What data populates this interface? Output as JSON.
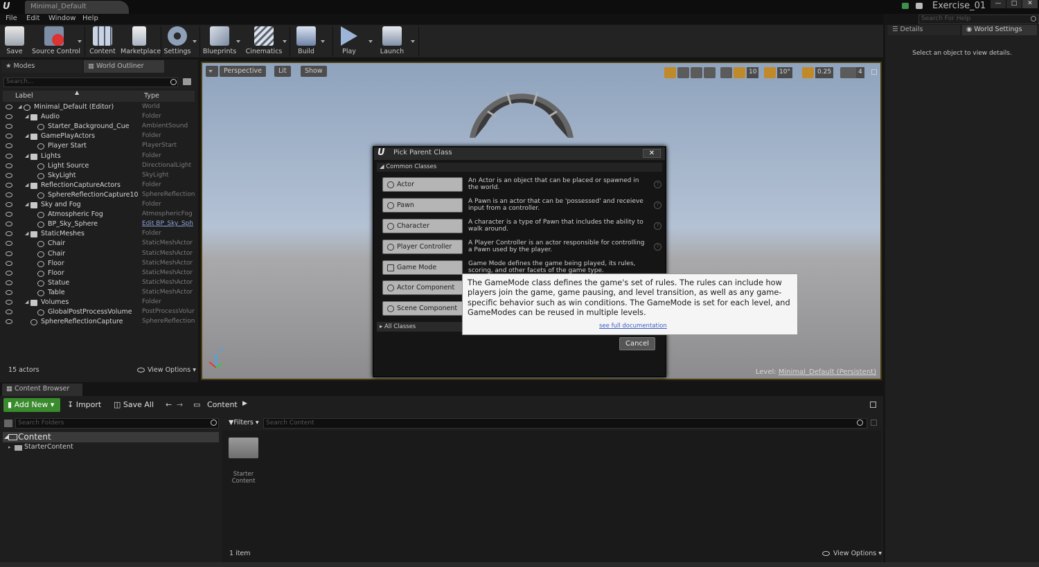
{
  "titlebar": {
    "doc_tab": "Minimal_Default",
    "project": "Exercise_01",
    "help_search_placeholder": "Search For Help",
    "win_buttons": [
      "—",
      "□",
      "✕"
    ]
  },
  "menu": [
    "File",
    "Edit",
    "Window",
    "Help"
  ],
  "toolbar": [
    "Save",
    "Source Control",
    "Content",
    "Marketplace",
    "Settings",
    "Blueprints",
    "Cinematics",
    "Build",
    "Play",
    "Launch"
  ],
  "left_tabs": {
    "modes": "Modes",
    "outliner": "World Outliner"
  },
  "outliner": {
    "search_placeholder": "Search...",
    "col_label": "Label",
    "col_type": "Type",
    "rows": [
      {
        "label": "Minimal_Default (Editor)",
        "type": "World"
      },
      {
        "label": "Audio",
        "type": "Folder"
      },
      {
        "label": "Starter_Background_Cue",
        "type": "AmbientSound"
      },
      {
        "label": "GamePlayActors",
        "type": "Folder"
      },
      {
        "label": "Player Start",
        "type": "PlayerStart"
      },
      {
        "label": "Lights",
        "type": "Folder"
      },
      {
        "label": "Light Source",
        "type": "DirectionalLight"
      },
      {
        "label": "SkyLight",
        "type": "SkyLight"
      },
      {
        "label": "ReflectionCaptureActors",
        "type": "Folder"
      },
      {
        "label": "SphereReflectionCapture10",
        "type": "SphereReflectionC"
      },
      {
        "label": "Sky and Fog",
        "type": "Folder"
      },
      {
        "label": "Atmospheric Fog",
        "type": "AtmosphericFog"
      },
      {
        "label": "BP_Sky_Sphere",
        "type": "Edit BP_Sky_Sph"
      },
      {
        "label": "StaticMeshes",
        "type": "Folder"
      },
      {
        "label": "Chair",
        "type": "StaticMeshActor"
      },
      {
        "label": "Chair",
        "type": "StaticMeshActor"
      },
      {
        "label": "Floor",
        "type": "StaticMeshActor"
      },
      {
        "label": "Floor",
        "type": "StaticMeshActor"
      },
      {
        "label": "Statue",
        "type": "StaticMeshActor"
      },
      {
        "label": "Table",
        "type": "StaticMeshActor"
      },
      {
        "label": "Volumes",
        "type": "Folder"
      },
      {
        "label": "GlobalPostProcessVolume",
        "type": "PostProcessVolur"
      },
      {
        "label": "SphereReflectionCapture",
        "type": "SphereReflectionC"
      }
    ],
    "actor_count": "15 actors",
    "view_options": "View Options"
  },
  "viewport": {
    "perspective": "Perspective",
    "lit": "Lit",
    "show": "Show",
    "grid_snap": "10",
    "rot_snap": "10°",
    "scale_snap": "0.25",
    "cam_speed": "4",
    "level_prefix": "Level:",
    "level_name": "Minimal_Default (Persistent)",
    "axis_z": "Z"
  },
  "dialog": {
    "title": "Pick Parent Class",
    "common_header": "Common Classes",
    "classes": [
      {
        "name": "Actor",
        "desc": "An Actor is an object that can be placed or spawned in the world."
      },
      {
        "name": "Pawn",
        "desc": "A Pawn is an actor that can be 'possessed' and receieve input from a controller."
      },
      {
        "name": "Character",
        "desc": "A character is a type of Pawn that includes the ability to walk around."
      },
      {
        "name": "Player Controller",
        "desc": "A Player Controller is an actor responsible for controlling a Pawn used by the player."
      },
      {
        "name": "Game Mode",
        "desc": "Game Mode defines the game being played, its rules, scoring, and other facets of the game type."
      },
      {
        "name": "Actor Component",
        "desc": ""
      },
      {
        "name": "Scene Component",
        "desc": ""
      }
    ],
    "all_classes": "All Classes",
    "cancel": "Cancel",
    "close": "✕"
  },
  "tooltip": {
    "text": "The GameMode class defines the game's set of rules. The rules can include how players join the game, game pausing, and level transition, as well as any game-specific behavior such as win conditions. The GameMode is set for each level, and GameModes can be reused in multiple levels.",
    "link": "see full documentation"
  },
  "content_browser": {
    "tab": "Content Browser",
    "add_new": "Add New",
    "import": "Import",
    "save_all": "Save All",
    "path": "Content",
    "folder_search_placeholder": "Search Folders",
    "filters": "Filters",
    "content_search_placeholder": "Search Content",
    "tree": [
      {
        "label": "Content"
      },
      {
        "label": "StarterContent"
      }
    ],
    "assets": [
      {
        "label": "Starter Content"
      }
    ],
    "item_count": "1 item",
    "view_options": "View Options"
  },
  "details": {
    "tab_details": "Details",
    "tab_world": "World Settings",
    "empty_msg": "Select an object to view details."
  },
  "colors": {
    "accent_green": "#3a8a2e",
    "viewport_border": "#4a3c10",
    "link": "#3c5dc4"
  }
}
